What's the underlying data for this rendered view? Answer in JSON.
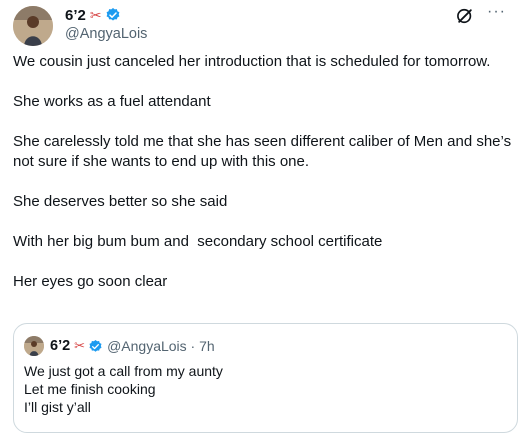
{
  "tweet": {
    "display_name": "6’2",
    "handle": "@AngyaLois",
    "paragraphs": [
      "We cousin just canceled her introduction that is scheduled for tomorrow.",
      "She works as a fuel attendant",
      "She carelessly told me that she has seen different caliber of Men and she’s not sure if she wants to end up with this one.",
      "She deserves better so she said",
      "With her big bum bum and  secondary school certificate",
      "Her eyes go soon clear"
    ],
    "more_label": "···"
  },
  "quote": {
    "display_name": "6’2",
    "handle_time": "@AngyaLois · 7h",
    "lines": "We just got a call from my aunty\nLet me finish cooking\nI’ll gist y’all"
  },
  "colors": {
    "verified": "#1d9bf0",
    "secondary_text": "#536471",
    "border": "#cfd9de"
  },
  "icons": [
    "scissors-icon",
    "verified-badge-icon",
    "grok-icon",
    "more-icon"
  ]
}
